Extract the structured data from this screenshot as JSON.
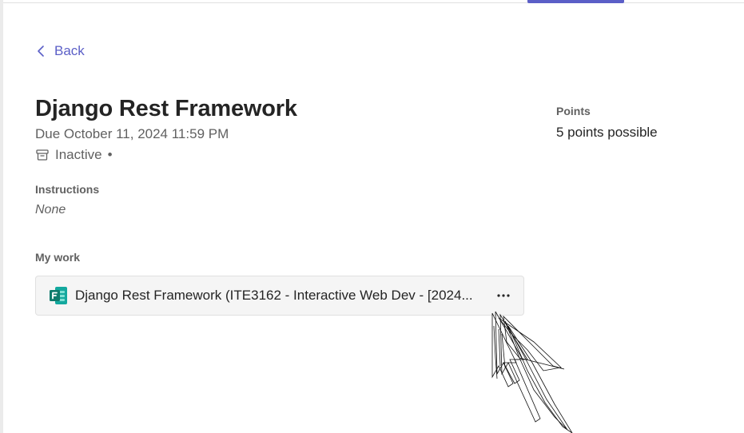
{
  "nav": {
    "back_label": "Back"
  },
  "assignment": {
    "title": "Django Rest Framework",
    "due": "Due October 11, 2024 11:59 PM",
    "status": "Inactive",
    "status_separator": "•"
  },
  "instructions": {
    "label": "Instructions",
    "value": "None"
  },
  "my_work": {
    "label": "My work",
    "file_name": "Django Rest Framework (ITE3162 - Interactive Web Dev - [2024...",
    "file_icon": "microsoft-forms-icon",
    "more_icon": "more-options-icon"
  },
  "points": {
    "label": "Points",
    "value": "5 points possible"
  },
  "colors": {
    "accent": "#5b5fc7",
    "text": "#242424",
    "muted": "#616161",
    "forms_green": "#0f7b6c"
  }
}
